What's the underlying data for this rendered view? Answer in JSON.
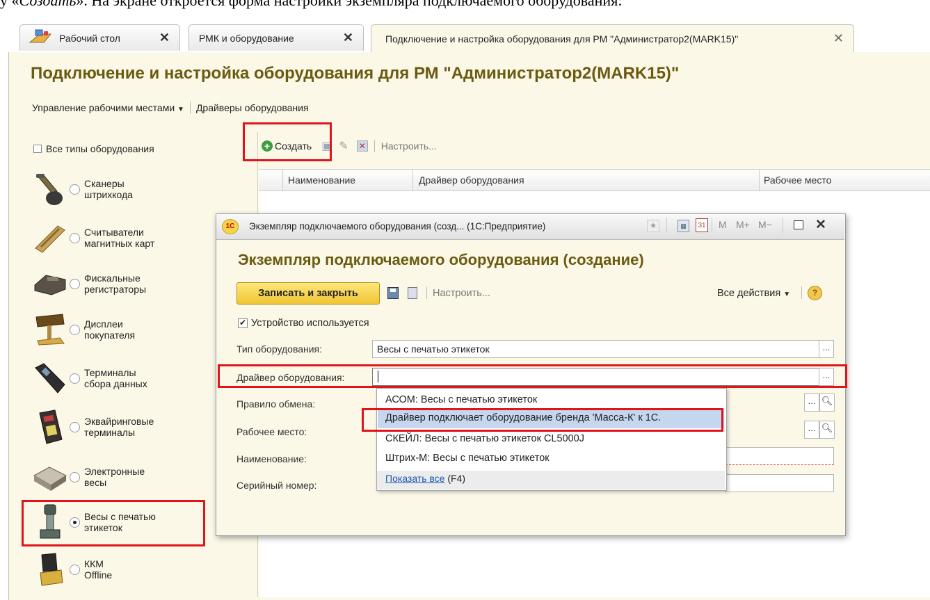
{
  "doc_text": {
    "prefix": "у «",
    "italic": "Создать",
    "suffix": "». На экране откроется форма настройки экземпляра подключаемого оборудования:"
  },
  "tabs": [
    {
      "label": "Рабочий стол",
      "close": "✕"
    },
    {
      "label": "РМК и оборудование",
      "close": "✕"
    },
    {
      "label": "Подключение и настройка оборудования для РМ \"Администратор2(MARK15)\"",
      "close": "✕"
    }
  ],
  "main_title": "Подключение и настройка оборудования для РМ \"Администратор2(MARK15)\"",
  "command_bar": {
    "manage": "Управление рабочими местами",
    "drivers": "Драйверы оборудования"
  },
  "left_panel": {
    "all_types": "Все типы оборудования",
    "items": [
      {
        "line1": "Сканеры",
        "line2": "штрихкода",
        "selected": false,
        "icon": "barcode-scanner-icon"
      },
      {
        "line1": "Считыватели",
        "line2": "магнитных карт",
        "selected": false,
        "icon": "card-reader-icon"
      },
      {
        "line1": "Фискальные",
        "line2": "регистраторы",
        "selected": false,
        "icon": "fiscal-register-icon"
      },
      {
        "line1": "Дисплеи",
        "line2": "покупателя",
        "selected": false,
        "icon": "customer-display-icon"
      },
      {
        "line1": "Терминалы",
        "line2": "сбора данных",
        "selected": false,
        "icon": "data-terminal-icon"
      },
      {
        "line1": "Эквайринговые",
        "line2": "терминалы",
        "selected": false,
        "icon": "pos-terminal-icon"
      },
      {
        "line1": "Электронные",
        "line2": "весы",
        "selected": false,
        "icon": "scale-icon"
      },
      {
        "line1": "Весы с печатью",
        "line2": "этикеток",
        "selected": true,
        "icon": "label-scale-icon"
      },
      {
        "line1": "ККМ",
        "line2": "Offline",
        "selected": false,
        "icon": "cash-register-icon"
      }
    ]
  },
  "list_toolbar": {
    "create": "Создать",
    "configure": "Настроить..."
  },
  "grid": {
    "columns": [
      "Наименование",
      "Драйвер оборудования",
      "Рабочее место"
    ]
  },
  "dialog": {
    "window_title": "Экземпляр подключаемого оборудования (созд... (1С:Предприятие)",
    "title_buttons": [
      "M",
      "M+",
      "M−"
    ],
    "heading": "Экземпляр подключаемого оборудования (создание)",
    "save_close": "Записать и закрыть",
    "configure": "Настроить...",
    "all_actions": "Все действия",
    "help": "?",
    "in_use": "Устройство используется",
    "fields": {
      "type_label": "Тип оборудования:",
      "type_value": "Весы с печатью этикеток",
      "driver_label": "Драйвер оборудования:",
      "driver_value": "",
      "exchange_label": "Правило обмена:",
      "workplace_label": "Рабочее место:",
      "name_label": "Наименование:",
      "serial_label": "Серийный номер:"
    },
    "dropdown": {
      "items": [
        "АСОМ: Весы с печатью этикеток",
        "Драйвер подключает оборудование бренда 'Масса-К' к 1С.",
        "СКЕЙЛ: Весы с печатью этикеток CL5000J",
        "Штрих-М: Весы с печатью этикеток"
      ],
      "highlighted_index": 1,
      "show_all": "Показать все",
      "show_all_key": "(F4)"
    }
  },
  "colors": {
    "accent_title": "#6b5a10",
    "highlight_box": "#e3131b",
    "panel_bg": "#fbf8e8",
    "selection": "#c4d7ef"
  }
}
